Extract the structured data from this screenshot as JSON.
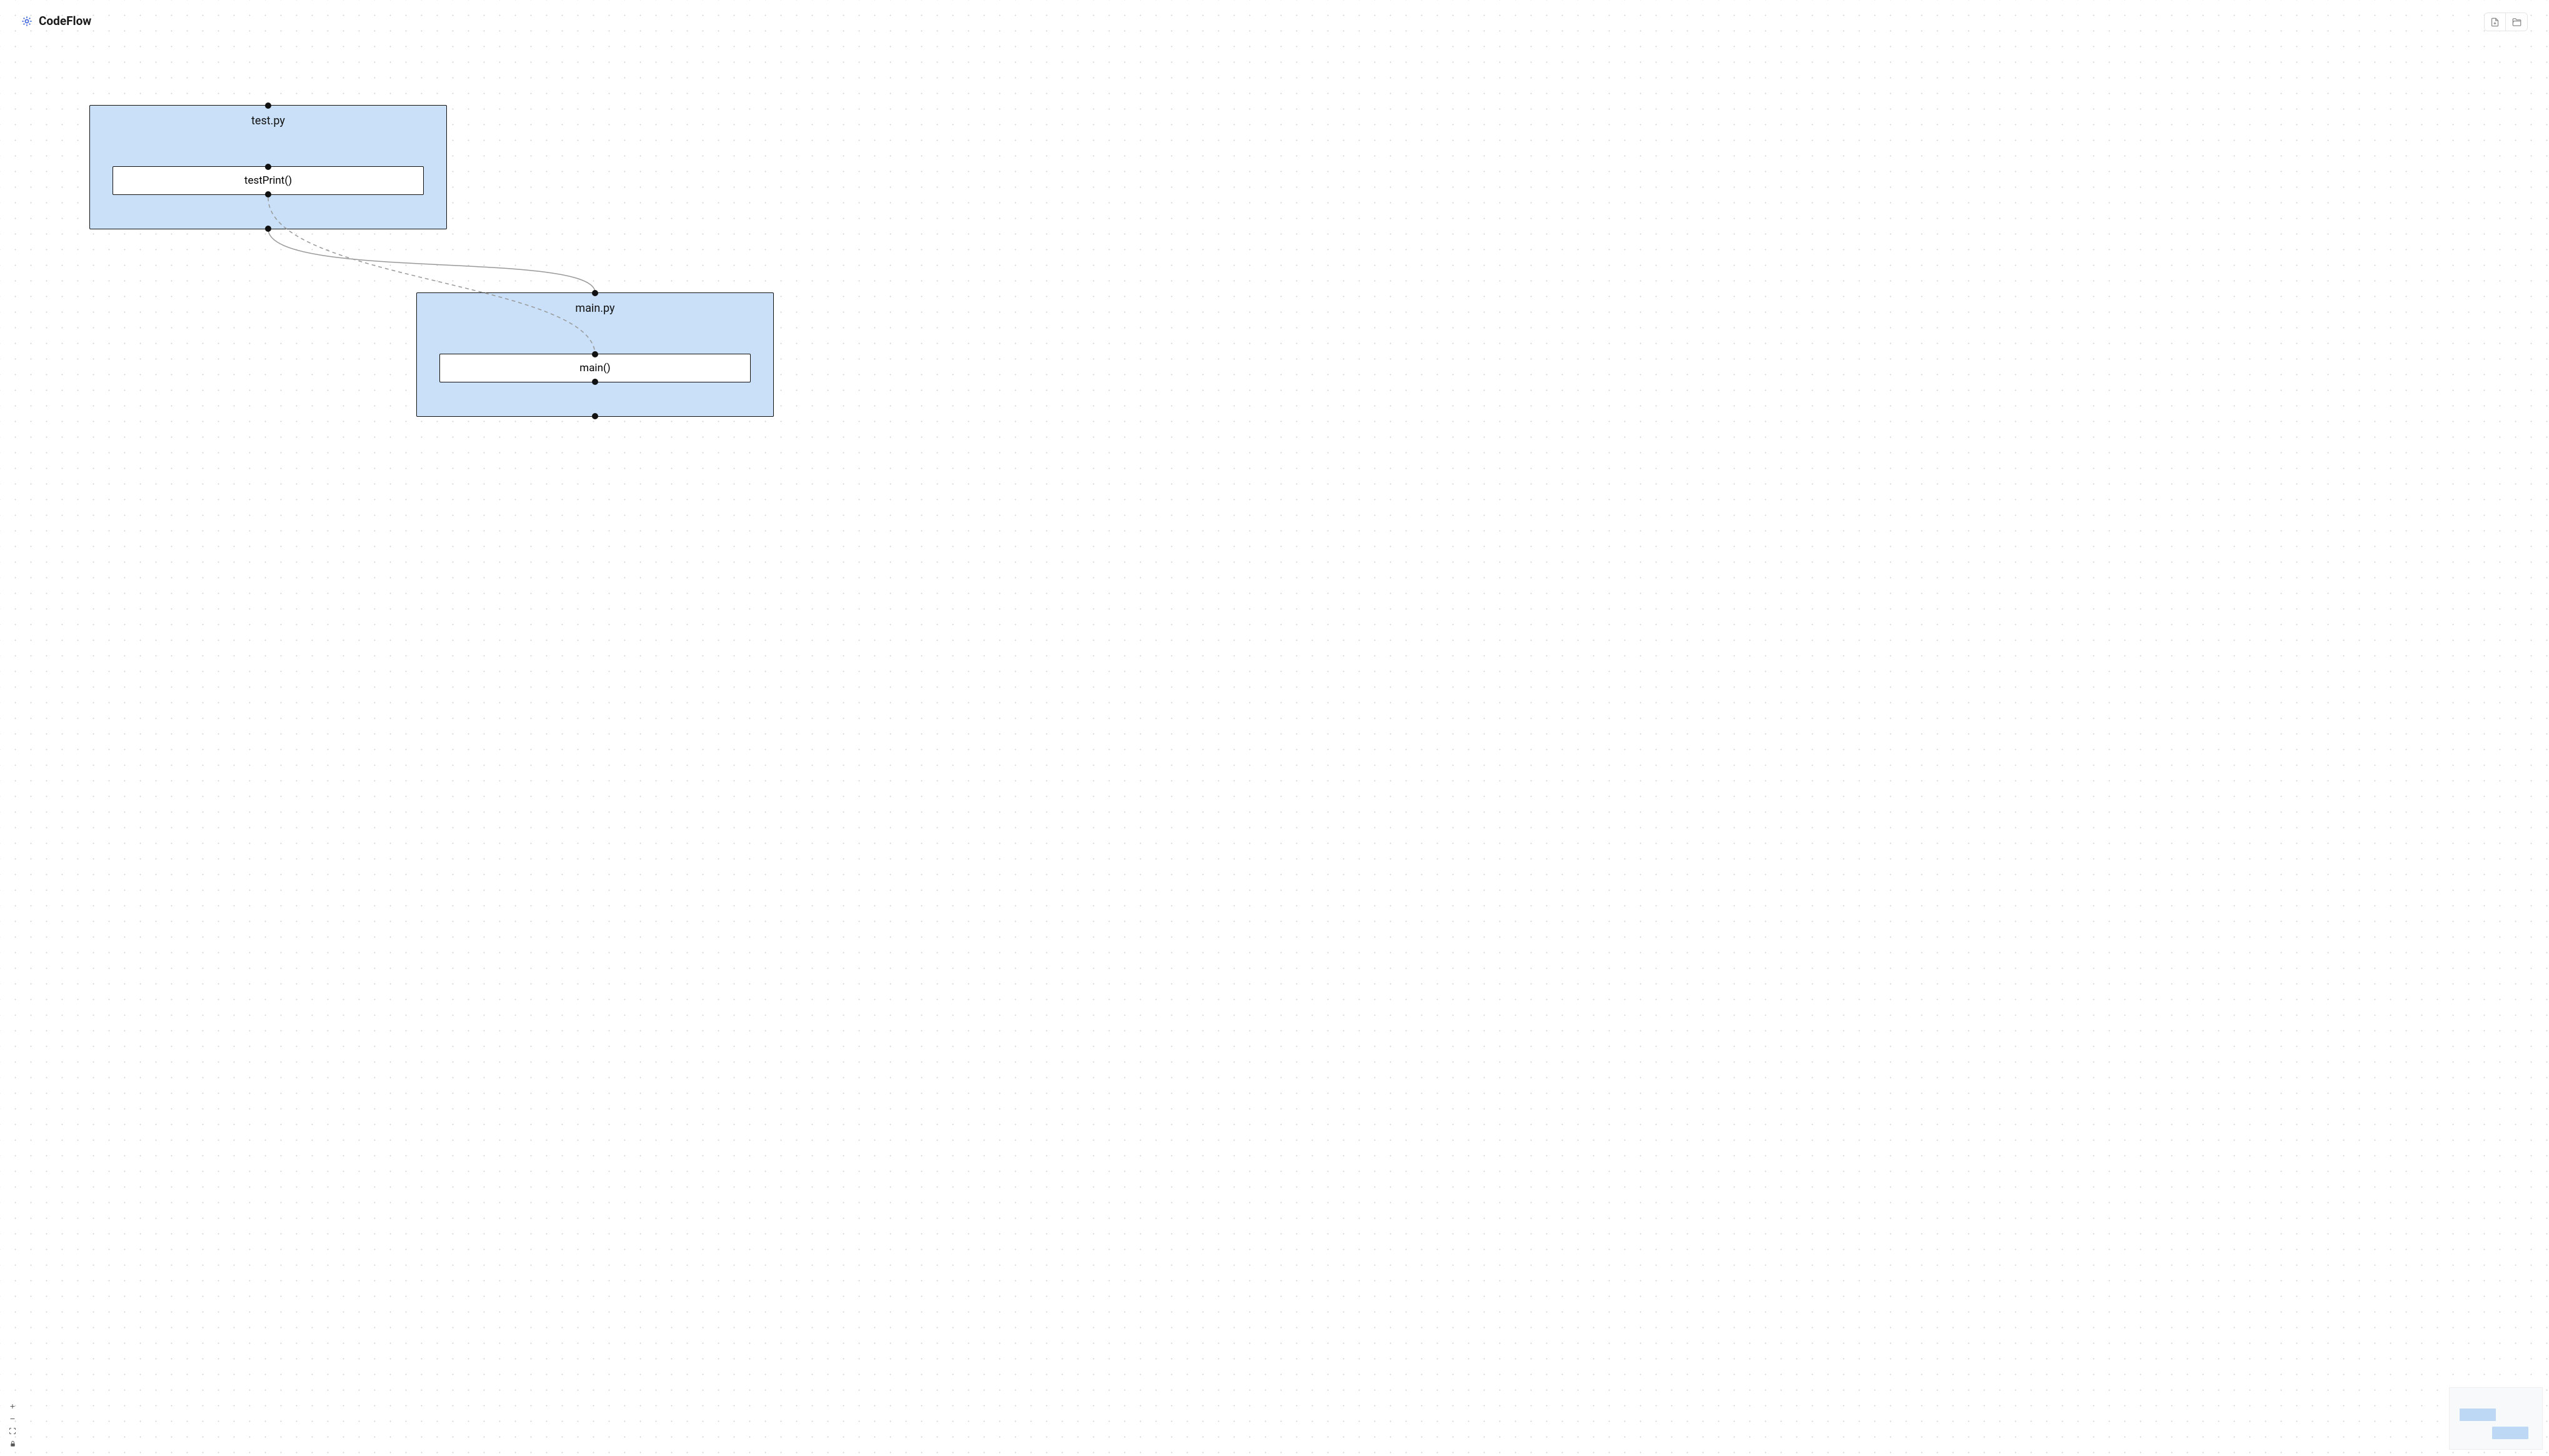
{
  "app": {
    "title": "CodeFlow"
  },
  "toolbar": {
    "save_icon": "save-file-icon",
    "open_icon": "folder-open-icon"
  },
  "nodes": {
    "file1": {
      "title": "test.py",
      "func": "testPrint()"
    },
    "file2": {
      "title": "main.py",
      "func": "main()"
    }
  },
  "edges": [
    {
      "from": "file1.bottom",
      "to": "file2.top",
      "style": "solid"
    },
    {
      "from": "file1.func.bottom",
      "to": "file2.func.top",
      "style": "dashed"
    }
  ],
  "zoom": {
    "in": "+",
    "out": "−",
    "fit": "fit",
    "lock": "lock"
  }
}
